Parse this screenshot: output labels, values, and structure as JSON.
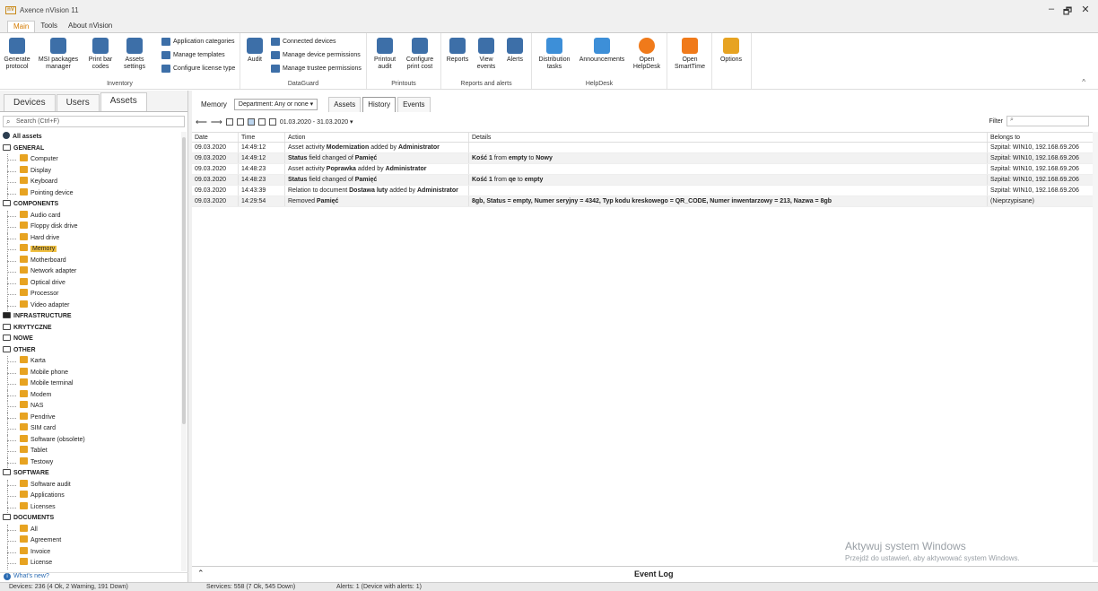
{
  "window": {
    "logo": "nV",
    "title": "Axence nVision 11",
    "controls": [
      "–",
      "🗗",
      "✕"
    ]
  },
  "menu_tabs": [
    {
      "label": "Main",
      "active": true
    },
    {
      "label": "Tools"
    },
    {
      "label": "About nVision"
    }
  ],
  "ribbon": {
    "groups": [
      {
        "label": "Inventory",
        "buttons": [
          {
            "label": "Generate\nprotocol",
            "icon": "report-icon"
          },
          {
            "label": "MSI packages\nmanager",
            "icon": "package-icon"
          },
          {
            "label": "Print bar\ncodes",
            "icon": "printer-icon"
          },
          {
            "label": "Assets\nsettings",
            "icon": "settings-icon"
          }
        ],
        "small": [
          "Application categories",
          "Manage templates",
          "Configure license type"
        ]
      },
      {
        "label": "DataGuard",
        "buttons": [
          {
            "label": "Audit",
            "icon": "audit-icon"
          }
        ],
        "small": [
          "Connected devices",
          "Manage device permissions",
          "Manage trustee permissions"
        ]
      },
      {
        "label": "Printouts",
        "buttons": [
          {
            "label": "Printout\naudit",
            "icon": "printer-audit-icon"
          },
          {
            "label": "Configure\nprint cost",
            "icon": "printer-cost-icon"
          }
        ]
      },
      {
        "label": "Reports and alerts",
        "buttons": [
          {
            "label": "Reports",
            "icon": "reports-icon"
          },
          {
            "label": "View\nevents",
            "icon": "events-icon"
          },
          {
            "label": "Alerts",
            "icon": "alerts-icon"
          }
        ]
      },
      {
        "label": "HelpDesk",
        "buttons": [
          {
            "label": "Distribution\ntasks",
            "icon": "distribution-icon"
          },
          {
            "label": "Announcements",
            "icon": "announcement-icon"
          },
          {
            "label": "Open\nHelpDesk",
            "icon": "lifebuoy-icon"
          }
        ]
      },
      {
        "label": "",
        "buttons": [
          {
            "label": "Open\nSmartTime",
            "icon": "smarttime-icon"
          }
        ]
      },
      {
        "label": "",
        "buttons": [
          {
            "label": "Options",
            "icon": "gears-icon"
          }
        ]
      }
    ]
  },
  "left_tabs": [
    {
      "label": "Devices"
    },
    {
      "label": "Users"
    },
    {
      "label": "Assets",
      "active": true
    }
  ],
  "search": {
    "placeholder": "Search (Ctrl+F)"
  },
  "tree": [
    {
      "label": "All assets",
      "type": "root"
    },
    {
      "label": "GENERAL",
      "type": "cat"
    },
    {
      "label": "Computer",
      "type": "item"
    },
    {
      "label": "Display",
      "type": "item"
    },
    {
      "label": "Keyboard",
      "type": "item"
    },
    {
      "label": "Pointing device",
      "type": "item"
    },
    {
      "label": "COMPONENTS",
      "type": "cat"
    },
    {
      "label": "Audio card",
      "type": "item"
    },
    {
      "label": "Floppy disk drive",
      "type": "item"
    },
    {
      "label": "Hard drive",
      "type": "item"
    },
    {
      "label": "Memory",
      "type": "item",
      "selected": true
    },
    {
      "label": "Motherboard",
      "type": "item"
    },
    {
      "label": "Network adapter",
      "type": "item"
    },
    {
      "label": "Optical drive",
      "type": "item"
    },
    {
      "label": "Processor",
      "type": "item"
    },
    {
      "label": "Video adapter",
      "type": "item"
    },
    {
      "label": "INFRASTRUCTURE",
      "type": "cat-filled"
    },
    {
      "label": "KRYTYCZNE",
      "type": "cat"
    },
    {
      "label": "NOWE",
      "type": "cat"
    },
    {
      "label": "OTHER",
      "type": "cat"
    },
    {
      "label": "Karta",
      "type": "item"
    },
    {
      "label": "Mobile phone",
      "type": "item"
    },
    {
      "label": "Mobile terminal",
      "type": "item"
    },
    {
      "label": "Modem",
      "type": "item"
    },
    {
      "label": "NAS",
      "type": "item"
    },
    {
      "label": "Pendrive",
      "type": "item"
    },
    {
      "label": "SIM card",
      "type": "item"
    },
    {
      "label": "Software (obsolete)",
      "type": "item"
    },
    {
      "label": "Tablet",
      "type": "item"
    },
    {
      "label": "Testowy",
      "type": "item"
    },
    {
      "label": "SOFTWARE",
      "type": "cat"
    },
    {
      "label": "Software audit",
      "type": "item"
    },
    {
      "label": "Applications",
      "type": "item"
    },
    {
      "label": "Licenses",
      "type": "item"
    },
    {
      "label": "DOCUMENTS",
      "type": "cat"
    },
    {
      "label": "All",
      "type": "item"
    },
    {
      "label": "Agreement",
      "type": "item"
    },
    {
      "label": "Invoice",
      "type": "item"
    },
    {
      "label": "License",
      "type": "item"
    }
  ],
  "whats_new": "What's new?",
  "main": {
    "context_label": "Memory",
    "department": "Department: Any or none ▾",
    "view_tabs": [
      {
        "label": "Assets"
      },
      {
        "label": "History",
        "active": true
      },
      {
        "label": "Events"
      }
    ],
    "date_range": "01.03.2020 - 31.03.2020 ▾",
    "filter_label": "Filter",
    "columns": [
      "Date",
      "Time",
      "Action",
      "Details",
      "Belongs to"
    ],
    "rows": [
      {
        "date": "09.03.2020",
        "time": "14:49:12",
        "action": "Asset activity <b>Modernization</b> added by <b>Administrator</b>",
        "details": "",
        "belongs": "Szpital: WIN10, 192.168.69.206"
      },
      {
        "date": "09.03.2020",
        "time": "14:49:12",
        "action": "<b>Status</b> field changed of <b>Pamięć</b>",
        "details": "<b>Kość 1</b> from <b>empty</b> to <b>Nowy</b>",
        "belongs": "Szpital: WIN10, 192.168.69.206"
      },
      {
        "date": "09.03.2020",
        "time": "14:48:23",
        "action": "Asset activity <b>Poprawka</b> added by <b>Administrator</b>",
        "details": "",
        "belongs": "Szpital: WIN10, 192.168.69.206"
      },
      {
        "date": "09.03.2020",
        "time": "14:48:23",
        "action": "<b>Status</b> field changed of <b>Pamięć</b>",
        "details": "<b>Kość 1</b> from <b>qe</b> to <b>empty</b>",
        "belongs": "Szpital: WIN10, 192.168.69.206"
      },
      {
        "date": "09.03.2020",
        "time": "14:43:39",
        "action": "Relation to document <b>Dostawa luty</b> added by <b>Administrator</b>",
        "details": "",
        "belongs": "Szpital: WIN10, 192.168.69.206"
      },
      {
        "date": "09.03.2020",
        "time": "14:29:54",
        "action": "Removed <b>Pamięć</b>",
        "details": "<b>8gb, Status = empty, Numer seryjny = 4342, Typ kodu kreskowego = QR_CODE, Numer inwentarzowy = 213, Nazwa = 8gb</b>",
        "belongs": "(Nieprzypisane)"
      }
    ],
    "event_log": "Event Log"
  },
  "watermark": {
    "line1": "Aktywuj system Windows",
    "line2": "Przejdź do ustawień, aby aktywować system Windows."
  },
  "status": {
    "devices": "Devices: 236 (4 Ok, 2 Warning, 191 Down)",
    "services": "Services: 558 (7 Ok, 545 Down)",
    "alerts": "Alerts: 1 (Device with alerts: 1)"
  },
  "colors": {
    "accent": "#d47a00",
    "icon_orange": "#e7a321",
    "icon_blue": "#3d6fa8",
    "selected": "#f0c040"
  }
}
